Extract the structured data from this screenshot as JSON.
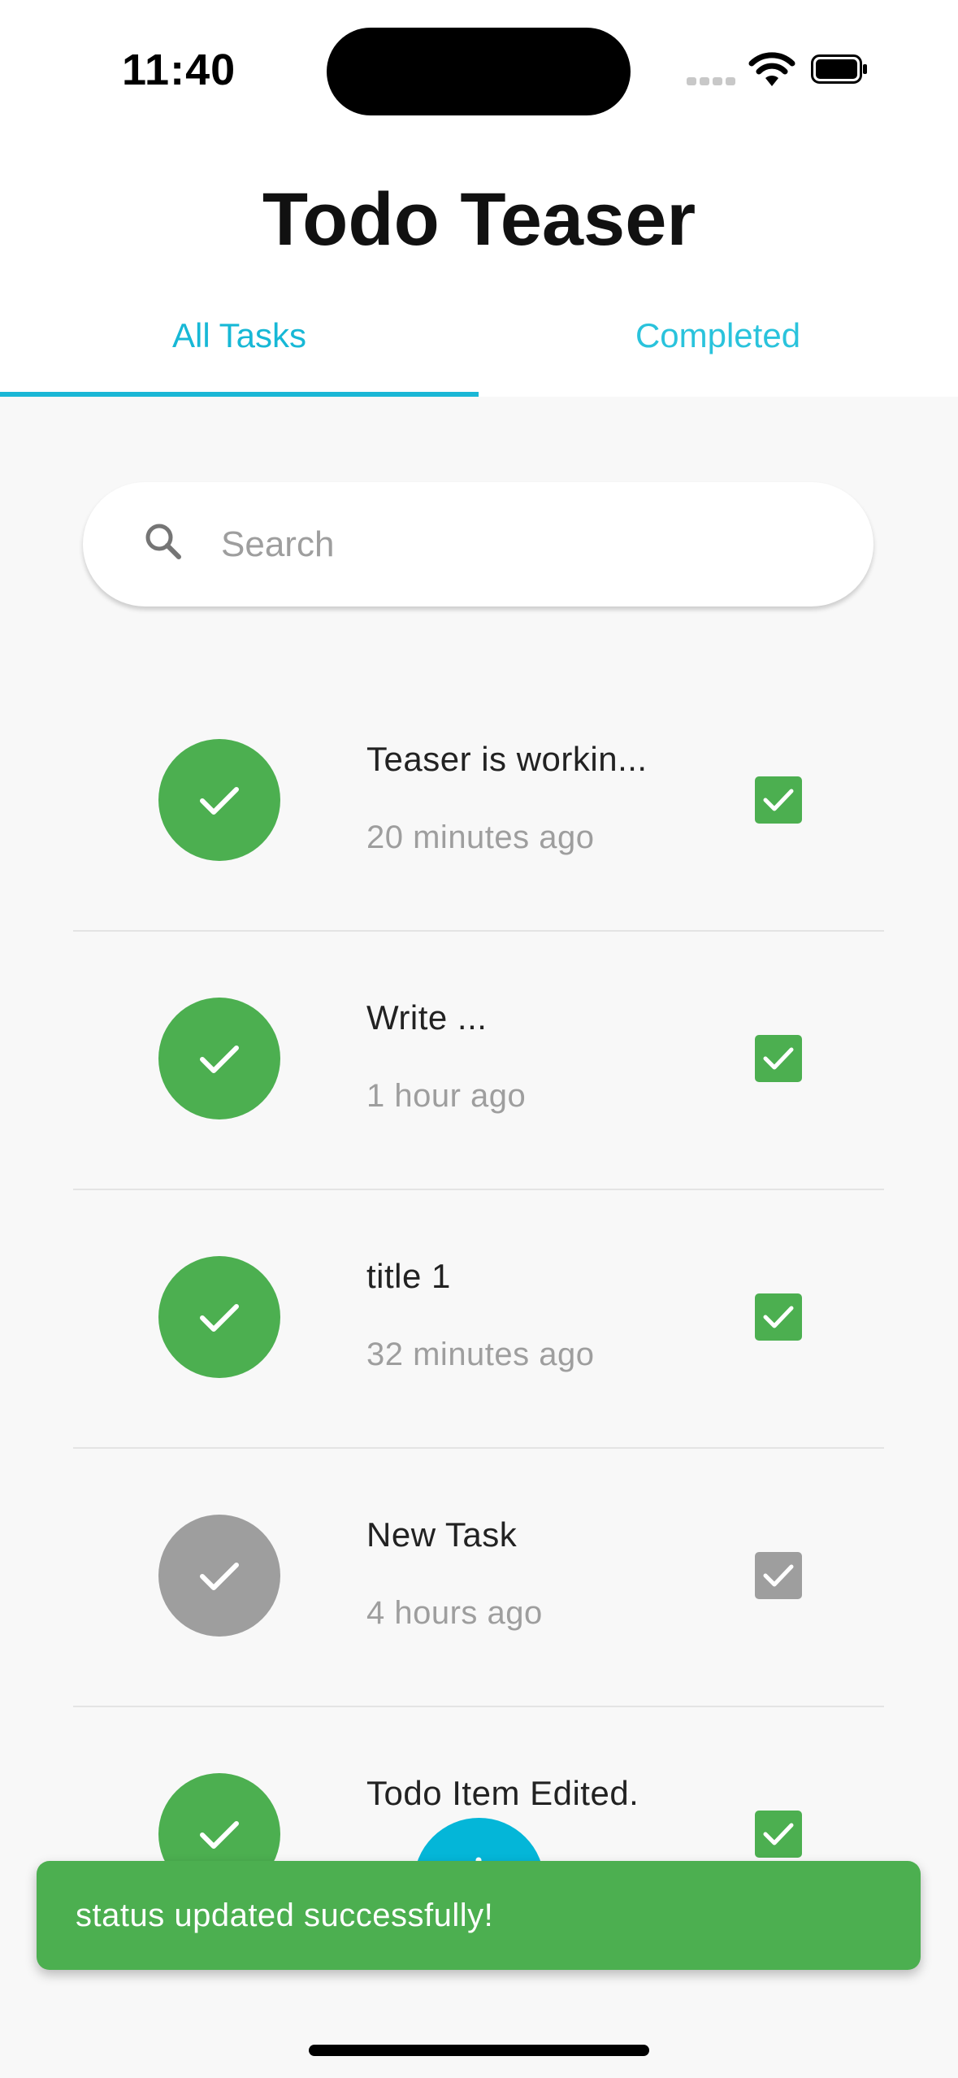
{
  "status_bar": {
    "time": "11:40"
  },
  "header": {
    "title": "Todo Teaser"
  },
  "tabs": [
    {
      "label": "All Tasks",
      "active": true
    },
    {
      "label": "Completed",
      "active": false
    }
  ],
  "search": {
    "placeholder": "Search",
    "value": ""
  },
  "tasks": [
    {
      "title": "Teaser is workin...",
      "time": "20 minutes ago",
      "completed": true
    },
    {
      "title": "Write ...",
      "time": "1 hour ago",
      "completed": true
    },
    {
      "title": "title 1",
      "time": "32 minutes ago",
      "completed": true
    },
    {
      "title": "New Task",
      "time": "4 hours ago",
      "completed": false
    },
    {
      "title": "Todo Item Edited.",
      "time": "",
      "completed": true
    }
  ],
  "snackbar": {
    "message": "status updated successfully!"
  },
  "colors": {
    "accent": "#1ab7d6",
    "completed": "#4caf50",
    "pending": "#9e9e9e",
    "fab": "#04b6d8"
  },
  "icons": {
    "search": "search-icon",
    "avatar": "check-icon",
    "checkbox": "checkbox-checked-icon",
    "fab": "add-icon"
  }
}
